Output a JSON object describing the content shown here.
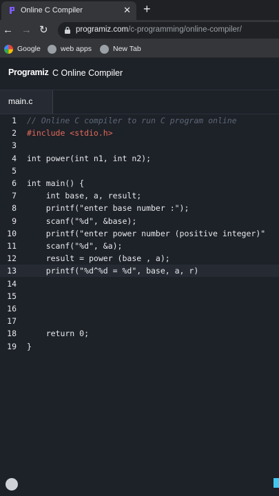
{
  "browser": {
    "tab_title": "Online C Compiler",
    "url_host": "programiz.com",
    "url_path": "/c-programming/online-compiler/",
    "bookmarks": [
      {
        "label": "Google",
        "icon": "google-icon"
      },
      {
        "label": "web apps",
        "icon": "web-apps-icon"
      },
      {
        "label": "New Tab",
        "icon": "new-tab-icon"
      }
    ]
  },
  "app": {
    "brand": "Programiz",
    "title": "C Online Compiler",
    "file_tab": "main.c"
  },
  "editor": {
    "lines": [
      {
        "num": "1",
        "text": "// Online C compiler to run C program online",
        "kind": "comment"
      },
      {
        "num": "2",
        "text": "#include <stdio.h>",
        "kind": "preprocessor"
      },
      {
        "num": "3",
        "text": "",
        "kind": "code"
      },
      {
        "num": "4",
        "text": "int power(int n1, int n2);",
        "kind": "code"
      },
      {
        "num": "5",
        "text": "",
        "kind": "code"
      },
      {
        "num": "6",
        "text": "int main() {",
        "kind": "code"
      },
      {
        "num": "7",
        "text": "    int base, a, result;",
        "kind": "code"
      },
      {
        "num": "8",
        "text": "    printf(\"enter base number :\");",
        "kind": "code"
      },
      {
        "num": "9",
        "text": "    scanf(\"%d\", &base);",
        "kind": "code"
      },
      {
        "num": "10",
        "text": "    printf(\"enter power number (positive integer)\"",
        "kind": "code"
      },
      {
        "num": "11",
        "text": "    scanf(\"%d\", &a);",
        "kind": "code"
      },
      {
        "num": "12",
        "text": "    result = power (base , a);",
        "kind": "code"
      },
      {
        "num": "13",
        "text": "    printf(\"%d^%d = %d\", base, a, r)",
        "kind": "code"
      },
      {
        "num": "14",
        "text": "",
        "kind": "code"
      },
      {
        "num": "15",
        "text": "",
        "kind": "code"
      },
      {
        "num": "16",
        "text": "",
        "kind": "code"
      },
      {
        "num": "17",
        "text": "",
        "kind": "code"
      },
      {
        "num": "18",
        "text": "    return 0;",
        "kind": "code"
      },
      {
        "num": "19",
        "text": "}",
        "kind": "code"
      }
    ],
    "active_line": 13
  },
  "colors": {
    "editor_bg": "#1d2128",
    "comment": "#5e6876",
    "preprocessor": "#e36a5b",
    "text": "#e8eaed"
  }
}
